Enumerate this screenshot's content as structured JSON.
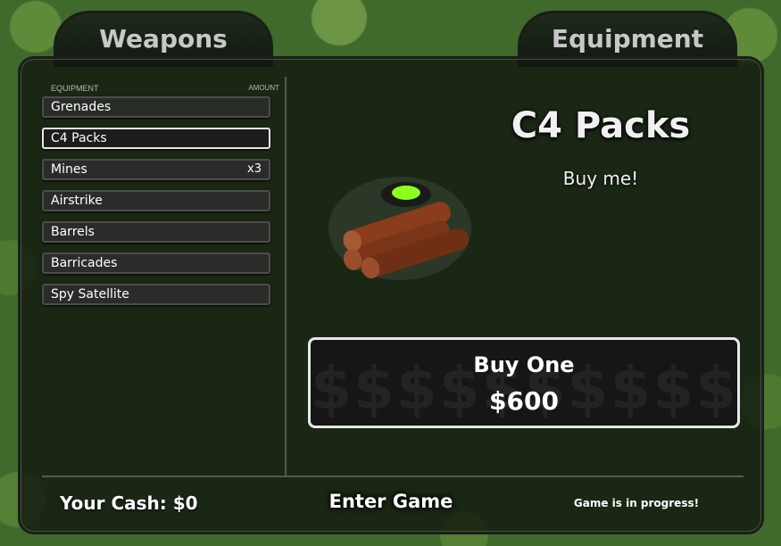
{
  "tabs": {
    "weapons": "Weapons",
    "equipment": "Equipment"
  },
  "list": {
    "header_left": "EQUIPMENT",
    "header_right": "AMOUNT",
    "items": [
      {
        "label": "Grenades",
        "qty": ""
      },
      {
        "label": "C4 Packs",
        "qty": "",
        "selected": true
      },
      {
        "label": "Mines",
        "qty": "x3"
      },
      {
        "label": "Airstrike",
        "qty": ""
      },
      {
        "label": "Barrels",
        "qty": ""
      },
      {
        "label": "Barricades",
        "qty": ""
      },
      {
        "label": "Spy Satellite",
        "qty": ""
      }
    ]
  },
  "detail": {
    "title": "C4 Packs",
    "subtitle": "Buy me!",
    "icon": "c4-pack-icon"
  },
  "buy": {
    "label": "Buy One",
    "price": "$600",
    "watermark": "$$$$$$$$$$$"
  },
  "footer": {
    "cash": "Your Cash: $0",
    "enter": "Enter Game",
    "status": "Game is in progress!"
  },
  "colors": {
    "panel": "#121810",
    "border_light": "#e8e8e8",
    "grass": "#3f6a2c"
  }
}
